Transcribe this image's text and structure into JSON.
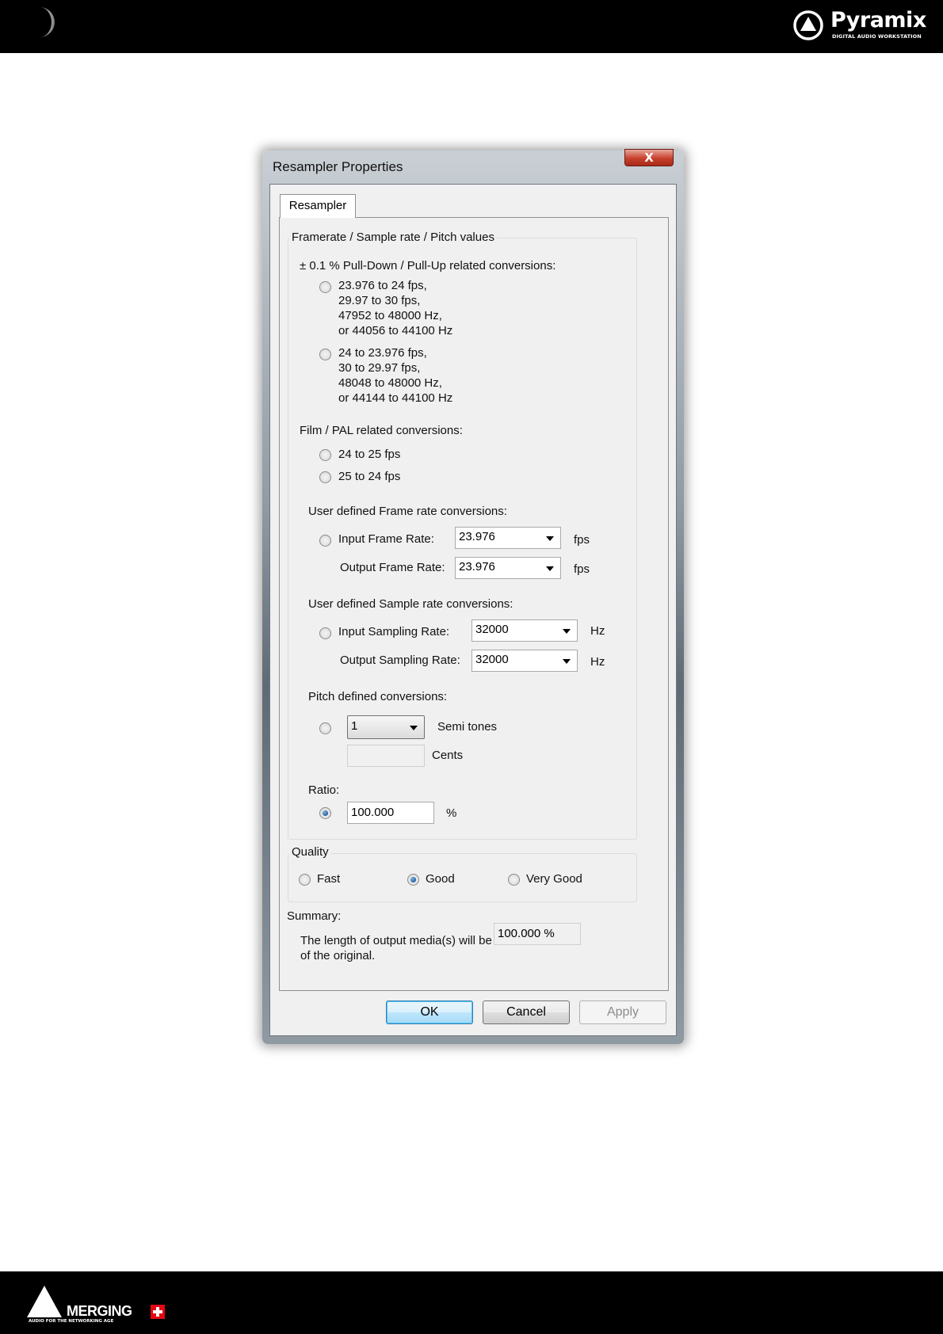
{
  "header": {
    "brand": "Pyramix",
    "brand_sub": "DIGITAL AUDIO WORKSTATION"
  },
  "footer": {
    "brand": "MERGING",
    "brand_sub": "AUDIO FOR THE NETWORKING AGE"
  },
  "dialog": {
    "title": "Resampler Properties",
    "close_label": "X",
    "tab": "Resampler",
    "group_values": {
      "legend": "Framerate / Sample rate / Pitch values",
      "pulldown_heading": "± 0.1 % Pull-Down / Pull-Up related conversions:",
      "pulldown_option1": [
        "23.976 to 24 fps,",
        "29.97 to 30 fps,",
        "47952 to 48000 Hz,",
        "or 44056 to 44100 Hz"
      ],
      "pulldown_option2": [
        "24 to 23.976 fps,",
        "30 to 29.97 fps,",
        "48048 to 48000 Hz,",
        "or 44144 to 44100 Hz"
      ],
      "film_heading": "Film / PAL related conversions:",
      "film_option1": "24 to 25 fps",
      "film_option2": "25 to 24 fps",
      "frame_heading": "User defined Frame rate conversions:",
      "input_frame_label": "Input Frame Rate:",
      "input_frame_value": "23.976",
      "output_frame_label": "Output Frame Rate:",
      "output_frame_value": "23.976",
      "fps_unit": "fps",
      "sample_heading": "User defined Sample rate conversions:",
      "input_sampling_label": "Input Sampling Rate:",
      "input_sampling_value": "32000",
      "output_sampling_label": "Output Sampling Rate:",
      "output_sampling_value": "32000",
      "hz_unit": "Hz",
      "pitch_heading": "Pitch defined conversions:",
      "semitones_value": "1",
      "semitones_label": "Semi tones",
      "cents_value": "",
      "cents_label": "Cents",
      "ratio_heading": "Ratio:",
      "ratio_value": "100.000",
      "percent_unit": "%"
    },
    "quality": {
      "legend": "Quality",
      "options": [
        "Fast",
        "Good",
        "Very Good"
      ],
      "selected": "Good"
    },
    "summary": {
      "heading": "Summary:",
      "text_line1": "The length of output media(s) will be",
      "text_line2": "of the original.",
      "value": "100.000 %"
    },
    "buttons": {
      "ok": "OK",
      "cancel": "Cancel",
      "apply": "Apply"
    }
  }
}
